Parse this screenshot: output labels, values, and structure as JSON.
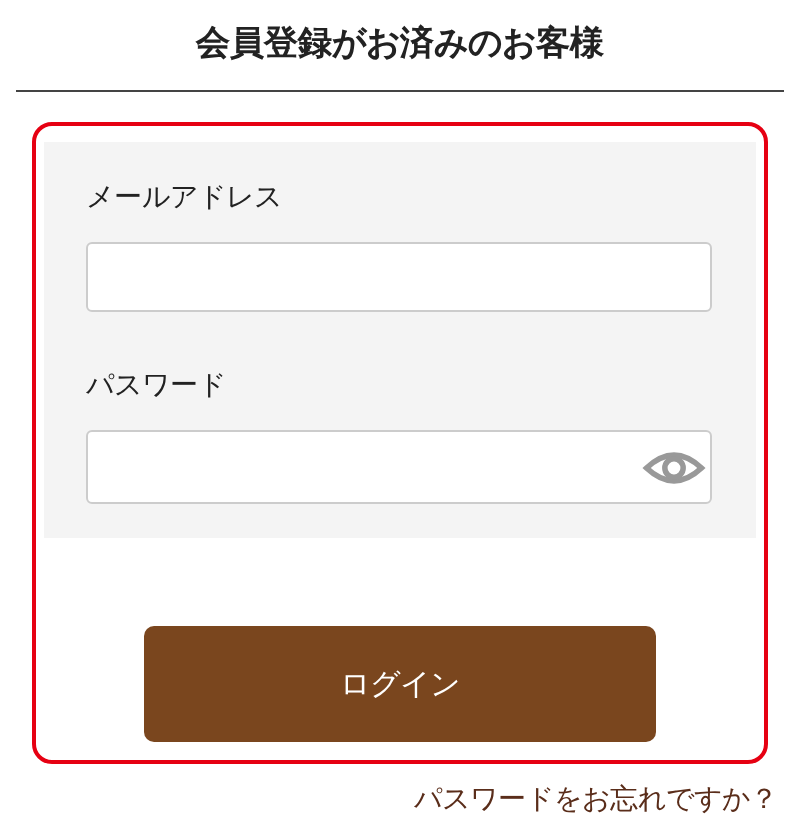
{
  "title": "会員登録がお済みのお客様",
  "form": {
    "fields": [
      {
        "label": "メールアドレス",
        "kind": "email"
      },
      {
        "label": "パスワード",
        "kind": "password"
      }
    ],
    "submit": "ログイン"
  },
  "forgot_link": "パスワードをお忘れですか？"
}
